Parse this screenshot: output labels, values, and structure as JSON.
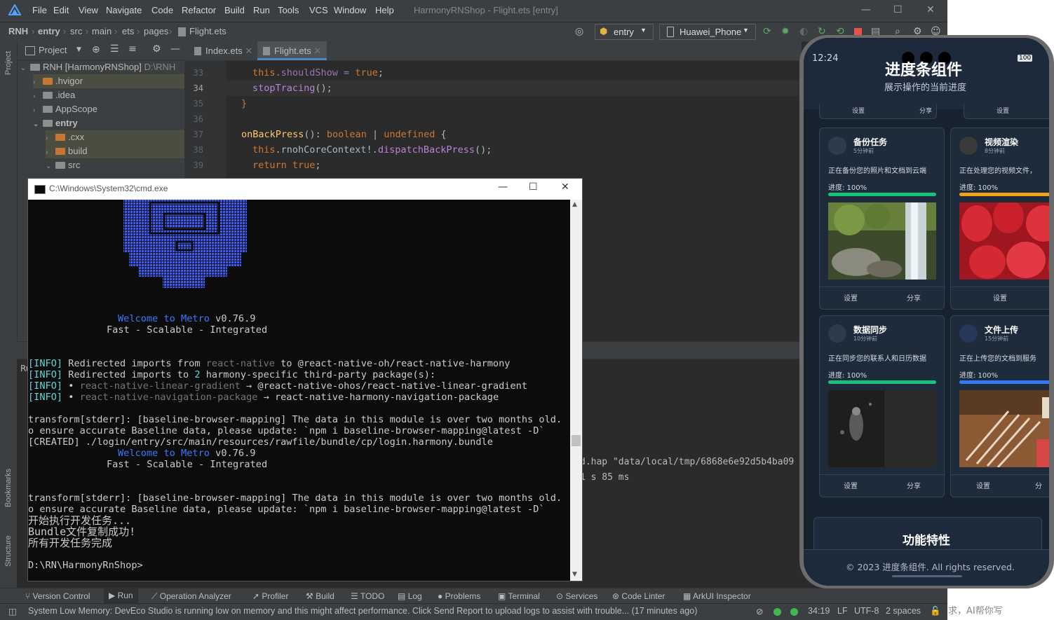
{
  "ide": {
    "menu": [
      "File",
      "Edit",
      "View",
      "Navigate",
      "Code",
      "Refactor",
      "Build",
      "Run",
      "Tools",
      "VCS",
      "Window",
      "Help"
    ],
    "window_title": "HarmonyRNShop - Flight.ets [entry]",
    "breadcrumb": [
      "RNH",
      "entry",
      "src",
      "main",
      "ets",
      "pages",
      "Flight.ets"
    ],
    "run_config": "entry",
    "device": "Huawei_Phone",
    "project_panel_title": "Project",
    "tree": [
      {
        "label": "RNH [HarmonyRNShop]",
        "suffix": "D:\\RNH"
      },
      {
        "label": ".hvigor"
      },
      {
        "label": ".idea"
      },
      {
        "label": "AppScope"
      },
      {
        "label": "entry"
      },
      {
        "label": ".cxx"
      },
      {
        "label": "build"
      },
      {
        "label": "src"
      }
    ],
    "tabs": [
      "Index.ets",
      "Flight.ets"
    ],
    "line_numbers": [
      "33",
      "34",
      "35",
      "36",
      "37",
      "38",
      "39"
    ],
    "code": {
      "l33_this": "this",
      "l33_rest": ".shouldShow = ",
      "l33_val": "true",
      "l33_end": ";",
      "l34_fn": "stopTracing",
      "l34_end": "();",
      "l35": "}",
      "l37_fn": "onBackPress",
      "l37_mid": "(): ",
      "l37_t1": "boolean",
      "l37_bar": " | ",
      "l37_t2": "undefined",
      "l37_end": " {",
      "l38_this": "this",
      "l38_rest": ".rnohCoreContext!.",
      "l38_fn": "dispatchBackPress",
      "l38_end": "();",
      "l39_kw": "return",
      "l39_val": " true",
      "l39_end": ";"
    },
    "run_label": "Ru",
    "run_output": [
      "d.hap \"data/local/tmp/6868e6e92d5b4ba09",
      "1 s 85 ms"
    ],
    "toolwindows": [
      "Version Control",
      "Run",
      "Operation Analyzer",
      "Profiler",
      "Build",
      "TODO",
      "Log",
      "Problems",
      "Terminal",
      "Services",
      "Code Linter",
      "ArkUI Inspector"
    ],
    "left_tools": [
      "Project",
      "Bookmarks",
      "Structure"
    ],
    "status_message": "System Low Memory: DevEco Studio is running low on memory and this might affect performance. Click Send Report to upload logs to assist with trouble... (17 minutes ago)",
    "status_right": [
      "34:19",
      "LF",
      "UTF-8",
      "2 spaces"
    ],
    "behind_text": "求，AI帮你写"
  },
  "cmd": {
    "title": "C:\\Windows\\System32\\cmd.exe",
    "metro_welcome": {
      "a": "Welcome",
      "b": "to",
      "c": "Metro",
      "d": "v0.76.9"
    },
    "metro_tagline": "Fast - Scalable - Integrated",
    "info_lines": [
      {
        "tag": "[INFO]",
        "text": " Redirected imports from ",
        "gray": "react-native",
        "tail": " to @react-native-oh/react-native-harmony"
      },
      {
        "tag": "[INFO]",
        "text": " Redirected imports to ",
        "gray": "2",
        "tail": " harmony-specific third-party package(s):"
      },
      {
        "tag": "[INFO]",
        "text": " • ",
        "gray": "react-native-linear-gradient",
        "tail": " → @react-native-ohos/react-native-linear-gradient"
      },
      {
        "tag": "[INFO]",
        "text": " • ",
        "gray": "react-native-navigation-package",
        "tail": " → react-native-harmony-navigation-package"
      }
    ],
    "warn1a": "transform[stderr]: [baseline-browser-mapping] The data in this module is over two months old.  T",
    "warn1b": "o ensure accurate Baseline data, please update: `npm i baseline-browser-mapping@latest -D`",
    "created": "[CREATED] ./login/entry/src/main/resources/rawfile/bundle/cp/login.harmony.bundle",
    "warn2a": "transform[stderr]: [baseline-browser-mapping] The data in this module is over two months old.  T",
    "warn2b": "o ensure accurate Baseline data, please update: `npm i baseline-browser-mapping@latest -D`",
    "zh1": "开始执行开发任务...",
    "zh2": "Bundle文件复制成功!",
    "zh3": "所有开发任务完成",
    "prompt": "D:\\RN\\HarmonyRnShop>"
  },
  "phone": {
    "time": "12:24",
    "battery": "100",
    "title": "进度条组件",
    "subtitle": "展示操作的当前进度",
    "top_buttons": [
      "设置",
      "分享",
      "设置"
    ],
    "cards": [
      {
        "title": "备份任务",
        "time": "5分钟前",
        "desc": "正在备份您的照片和文档到云端",
        "progress": "进度: 100%",
        "progress_value": 1.0,
        "bar_color": "#19c27a",
        "buttons": [
          "设置",
          "分享"
        ]
      },
      {
        "title": "视频渲染",
        "time": "8分钟前",
        "desc": "正在处理您的视频文件，",
        "progress": "进度: 100%",
        "progress_value": 1.0,
        "bar_color": "#f2a21d",
        "buttons": [
          "设置"
        ]
      },
      {
        "title": "数据同步",
        "time": "10分钟前",
        "desc": "正在同步您的联系人和日历数据",
        "progress": "进度: 100%",
        "progress_value": 1.0,
        "bar_color": "#19c27a",
        "buttons": [
          "设置",
          "分享"
        ]
      },
      {
        "title": "文件上传",
        "time": "15分钟前",
        "desc": "正在上传您的文档到服务",
        "progress": "进度: 100%",
        "progress_value": 1.0,
        "bar_color": "#3478f6",
        "buttons": [
          "设置",
          "分"
        ]
      }
    ],
    "features_title": "功能特性",
    "footer": "© 2023 进度条组件. All rights reserved."
  }
}
